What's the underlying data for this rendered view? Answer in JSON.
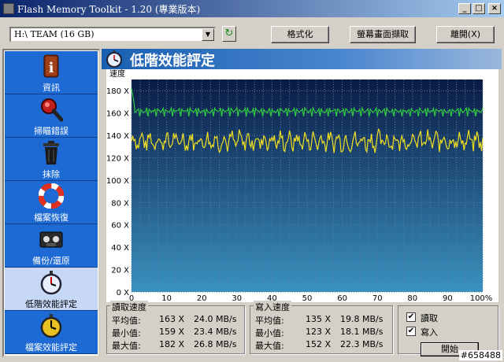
{
  "window": {
    "title": "Flash Memory Toolkit - 1.20 (專業版本)",
    "min_label": "_",
    "max_label": "□",
    "close_label": "×"
  },
  "toolbar": {
    "drive_value": "H:\\ TEAM (16 GB)",
    "dropdown_arrow": "▼",
    "refresh_glyph": "↻",
    "format_label": "格式化",
    "capture_label": "螢幕畫面擷取",
    "exit_label": "離開(X)"
  },
  "sidebar": {
    "items": [
      {
        "label": "資訊",
        "icon": "info-icon"
      },
      {
        "label": "掃瞄錯誤",
        "icon": "magnifier-icon"
      },
      {
        "label": "抹除",
        "icon": "trash-icon"
      },
      {
        "label": "檔案恢復",
        "icon": "lifebuoy-icon"
      },
      {
        "label": "備份/還原",
        "icon": "tape-icon"
      },
      {
        "label": "低階效能評定",
        "icon": "stopwatch-icon",
        "active": true
      },
      {
        "label": "檔案效能評定",
        "icon": "stopwatch-gold-icon"
      }
    ]
  },
  "banner": {
    "title": "低階效能評定"
  },
  "chart_data": {
    "type": "line",
    "ylabel": "速度",
    "y_ticks": [
      "0 X",
      "20 X",
      "40 X",
      "60 X",
      "80 X",
      "100 X",
      "120 X",
      "140 X",
      "160 X",
      "180 X"
    ],
    "x_ticks": [
      "0",
      "10",
      "20",
      "30",
      "40",
      "50",
      "60",
      "70",
      "80",
      "90",
      "100%"
    ],
    "ylim": [
      0,
      190
    ],
    "xlim": [
      0,
      100
    ],
    "grid": true,
    "series": [
      {
        "name": "讀取",
        "color": "#2ecc40",
        "min": 159,
        "avg": 163,
        "max": 182
      },
      {
        "name": "寫入",
        "color": "#f0e020",
        "min": 123,
        "avg": 135,
        "max": 152
      }
    ]
  },
  "read_stats": {
    "group_title": "讀取速度",
    "rows": [
      {
        "label": "平均值:",
        "x": "163 X",
        "mbs": "24.0 MB/s"
      },
      {
        "label": "最小值:",
        "x": "159 X",
        "mbs": "23.4 MB/s"
      },
      {
        "label": "最大值:",
        "x": "182 X",
        "mbs": "26.8 MB/s"
      }
    ]
  },
  "write_stats": {
    "group_title": "寫入速度",
    "rows": [
      {
        "label": "平均值:",
        "x": "135 X",
        "mbs": "19.8 MB/s"
      },
      {
        "label": "最小值:",
        "x": "123 X",
        "mbs": "18.1 MB/s"
      },
      {
        "label": "最大值:",
        "x": "152 X",
        "mbs": "22.3 MB/s"
      }
    ]
  },
  "options": {
    "read_label": "讀取",
    "write_label": "寫入",
    "read_checked": "✔",
    "write_checked": "✔",
    "start_label": "開始"
  },
  "watermark": "#658488"
}
